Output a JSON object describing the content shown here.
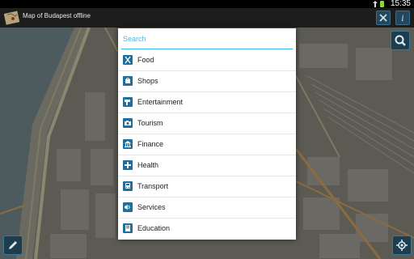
{
  "status_bar": {
    "time": "15:35"
  },
  "action_bar": {
    "title": "Map of Budapest offline"
  },
  "search": {
    "placeholder": "Search",
    "value": ""
  },
  "categories": [
    {
      "label": "Food",
      "icon": "food-icon"
    },
    {
      "label": "Shops",
      "icon": "shops-icon"
    },
    {
      "label": "Entertainment",
      "icon": "entertainment-icon"
    },
    {
      "label": "Tourism",
      "icon": "tourism-icon"
    },
    {
      "label": "Finance",
      "icon": "finance-icon"
    },
    {
      "label": "Health",
      "icon": "health-icon"
    },
    {
      "label": "Transport",
      "icon": "transport-icon"
    },
    {
      "label": "Services",
      "icon": "services-icon"
    },
    {
      "label": "Education",
      "icon": "education-icon"
    }
  ],
  "colors": {
    "accent": "#33b5e5",
    "icon_bg": "#1f6f9e",
    "status_battery": "#8fd43d"
  }
}
